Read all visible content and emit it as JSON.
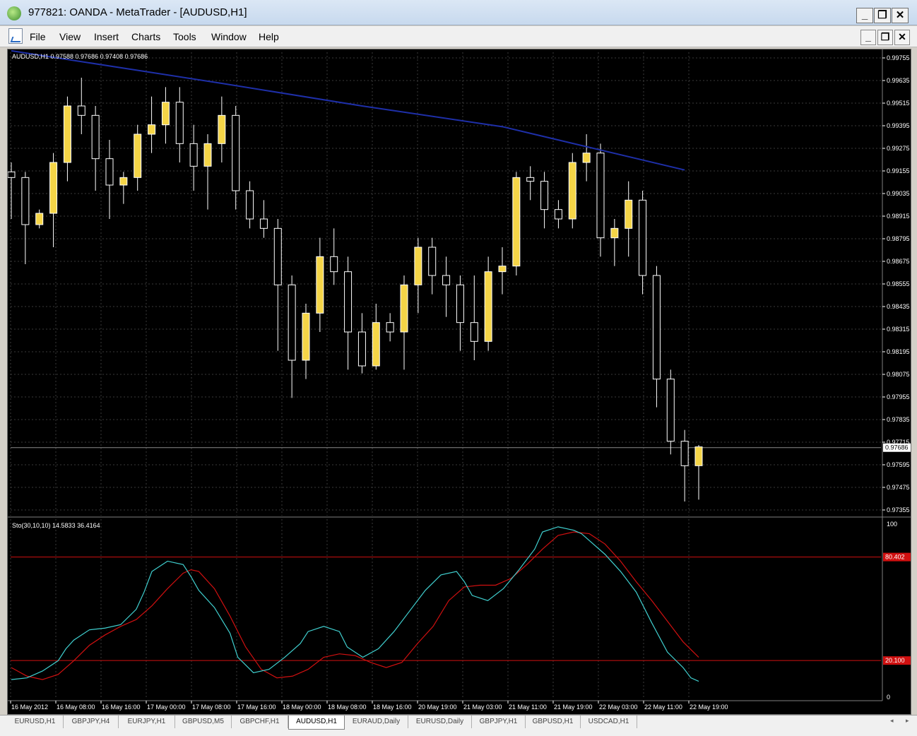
{
  "window": {
    "title": "977821: OANDA - MetaTrader - [AUDUSD,H1]",
    "min_glyph": "_",
    "restore_glyph": "❐",
    "close_glyph": "✕"
  },
  "menu": [
    "File",
    "View",
    "Insert",
    "Charts",
    "Tools",
    "Window",
    "Help"
  ],
  "chart": {
    "info_label": "AUDUSD,H1  0.97588 0.97686 0.97408 0.97686",
    "current_price": "0.97686",
    "price_ticks": [
      "0.99755",
      "0.99635",
      "0.99515",
      "0.99395",
      "0.99275",
      "0.99155",
      "0.99035",
      "0.98915",
      "0.98795",
      "0.98675",
      "0.98555",
      "0.98435",
      "0.98315",
      "0.98195",
      "0.98075",
      "0.97955",
      "0.97835",
      "0.97715",
      "0.97595",
      "0.97475",
      "0.97355"
    ],
    "time_labels": [
      "16 May 2012",
      "16 May 08:00",
      "16 May 16:00",
      "17 May 00:00",
      "17 May 08:00",
      "17 May 16:00",
      "18 May 00:00",
      "18 May 08:00",
      "18 May 16:00",
      "20 May 19:00",
      "21 May 03:00",
      "21 May 11:00",
      "21 May 19:00",
      "22 May 03:00",
      "22 May 11:00",
      "22 May 19:00"
    ],
    "colors": {
      "background": "#000000",
      "bull_body": "#f5d547",
      "bear_body": "#000000",
      "wick": "#ffffff",
      "ma": "#1e2fa8",
      "grid": "#3a3a3a"
    },
    "y_range": [
      0.97355,
      0.99755
    ],
    "ma_line": [
      [
        0,
        0.99793
      ],
      [
        15,
        0.9962
      ],
      [
        25,
        0.995
      ],
      [
        35,
        0.9939
      ],
      [
        48,
        0.9916
      ]
    ],
    "candles": [
      [
        0.9915,
        0.992,
        0.989,
        0.9912
      ],
      [
        0.9912,
        0.9915,
        0.9866,
        0.9887
      ],
      [
        0.9887,
        0.9895,
        0.9885,
        0.9893
      ],
      [
        0.9893,
        0.9925,
        0.9875,
        0.992
      ],
      [
        0.992,
        0.9955,
        0.991,
        0.995
      ],
      [
        0.995,
        0.9965,
        0.9935,
        0.9945
      ],
      [
        0.9945,
        0.995,
        0.9905,
        0.9922
      ],
      [
        0.9922,
        0.9932,
        0.989,
        0.9908
      ],
      [
        0.9908,
        0.9915,
        0.9898,
        0.9912
      ],
      [
        0.9912,
        0.994,
        0.9905,
        0.9935
      ],
      [
        0.9935,
        0.9955,
        0.9925,
        0.994
      ],
      [
        0.994,
        0.996,
        0.993,
        0.9952
      ],
      [
        0.9952,
        0.996,
        0.992,
        0.993
      ],
      [
        0.993,
        0.994,
        0.9905,
        0.9918
      ],
      [
        0.9918,
        0.9935,
        0.9895,
        0.993
      ],
      [
        0.993,
        0.9955,
        0.992,
        0.9945
      ],
      [
        0.9945,
        0.995,
        0.9895,
        0.9905
      ],
      [
        0.9905,
        0.991,
        0.9885,
        0.989
      ],
      [
        0.989,
        0.99,
        0.988,
        0.9885
      ],
      [
        0.9885,
        0.989,
        0.982,
        0.9855
      ],
      [
        0.9855,
        0.986,
        0.9795,
        0.9815
      ],
      [
        0.9815,
        0.9845,
        0.9805,
        0.984
      ],
      [
        0.984,
        0.988,
        0.983,
        0.987
      ],
      [
        0.987,
        0.9885,
        0.9855,
        0.9862
      ],
      [
        0.9862,
        0.987,
        0.981,
        0.983
      ],
      [
        0.983,
        0.984,
        0.9808,
        0.9812
      ],
      [
        0.9812,
        0.9845,
        0.981,
        0.9835
      ],
      [
        0.9835,
        0.984,
        0.9825,
        0.983
      ],
      [
        0.983,
        0.986,
        0.981,
        0.9855
      ],
      [
        0.9855,
        0.988,
        0.984,
        0.9875
      ],
      [
        0.9875,
        0.988,
        0.985,
        0.986
      ],
      [
        0.986,
        0.987,
        0.9838,
        0.9855
      ],
      [
        0.9855,
        0.986,
        0.982,
        0.9835
      ],
      [
        0.9835,
        0.986,
        0.9815,
        0.9825
      ],
      [
        0.9825,
        0.987,
        0.982,
        0.9862
      ],
      [
        0.9862,
        0.9875,
        0.985,
        0.9865
      ],
      [
        0.9865,
        0.9915,
        0.986,
        0.9912
      ],
      [
        0.9912,
        0.9918,
        0.99,
        0.991
      ],
      [
        0.991,
        0.9915,
        0.9885,
        0.9895
      ],
      [
        0.9895,
        0.99,
        0.9885,
        0.989
      ],
      [
        0.989,
        0.9925,
        0.9885,
        0.992
      ],
      [
        0.992,
        0.9935,
        0.991,
        0.9925
      ],
      [
        0.9925,
        0.993,
        0.987,
        0.988
      ],
      [
        0.988,
        0.989,
        0.9865,
        0.9885
      ],
      [
        0.9885,
        0.991,
        0.987,
        0.99
      ],
      [
        0.99,
        0.9905,
        0.985,
        0.986
      ],
      [
        0.986,
        0.9865,
        0.979,
        0.9805
      ],
      [
        0.9805,
        0.981,
        0.9765,
        0.9772
      ],
      [
        0.9772,
        0.9778,
        0.974,
        0.9759
      ],
      [
        0.9759,
        0.977,
        0.9741,
        0.9769
      ]
    ]
  },
  "stochastic": {
    "label": "Sto(30,10,10) 14.5833 36.4164",
    "scale_top": "100",
    "scale_bottom": "0",
    "level_high": "80.402",
    "level_low": "20.100",
    "level_high_value": 80.402,
    "level_low_value": 20.1,
    "main_color": "#40d0d0",
    "signal_color": "#d01010",
    "level_color": "#d01010",
    "main": [
      [
        0,
        9
      ],
      [
        2,
        10
      ],
      [
        4,
        14
      ],
      [
        6,
        20
      ],
      [
        7,
        27
      ],
      [
        8,
        32
      ],
      [
        10,
        38
      ],
      [
        12,
        39
      ],
      [
        14,
        41
      ],
      [
        16,
        50
      ],
      [
        17,
        60
      ],
      [
        18,
        72
      ],
      [
        20,
        78
      ],
      [
        22,
        76
      ],
      [
        23,
        69
      ],
      [
        24,
        61
      ],
      [
        26,
        51
      ],
      [
        28,
        36
      ],
      [
        29,
        22
      ],
      [
        31,
        13
      ],
      [
        33,
        15
      ],
      [
        35,
        22
      ],
      [
        37,
        30
      ],
      [
        38,
        37
      ],
      [
        40,
        40
      ],
      [
        42,
        37
      ],
      [
        43,
        28
      ],
      [
        45,
        22
      ],
      [
        47,
        27
      ],
      [
        49,
        37
      ],
      [
        51,
        49
      ],
      [
        53,
        61
      ],
      [
        55,
        70
      ],
      [
        57,
        72
      ],
      [
        58,
        66
      ],
      [
        59,
        58
      ],
      [
        61,
        55
      ],
      [
        63,
        62
      ],
      [
        65,
        73
      ],
      [
        67,
        85
      ],
      [
        68,
        95
      ],
      [
        70,
        98
      ],
      [
        72,
        96
      ],
      [
        73,
        94
      ],
      [
        74,
        90
      ],
      [
        76,
        82
      ],
      [
        78,
        72
      ],
      [
        80,
        60
      ],
      [
        82,
        42
      ],
      [
        84,
        25
      ],
      [
        86,
        16
      ],
      [
        87,
        10
      ],
      [
        88,
        8
      ]
    ],
    "signal": [
      [
        0,
        16
      ],
      [
        2,
        11
      ],
      [
        4,
        9
      ],
      [
        6,
        12
      ],
      [
        8,
        20
      ],
      [
        10,
        29
      ],
      [
        12,
        35
      ],
      [
        14,
        40
      ],
      [
        16,
        44
      ],
      [
        18,
        52
      ],
      [
        20,
        62
      ],
      [
        22,
        71
      ],
      [
        23,
        73
      ],
      [
        24,
        72
      ],
      [
        26,
        62
      ],
      [
        28,
        46
      ],
      [
        30,
        28
      ],
      [
        32,
        15
      ],
      [
        34,
        10
      ],
      [
        36,
        11
      ],
      [
        38,
        15
      ],
      [
        40,
        22
      ],
      [
        42,
        24
      ],
      [
        44,
        23
      ],
      [
        46,
        19
      ],
      [
        48,
        16
      ],
      [
        50,
        19
      ],
      [
        52,
        30
      ],
      [
        54,
        40
      ],
      [
        56,
        55
      ],
      [
        58,
        63
      ],
      [
        60,
        64
      ],
      [
        62,
        64
      ],
      [
        64,
        68
      ],
      [
        66,
        76
      ],
      [
        68,
        85
      ],
      [
        70,
        93
      ],
      [
        72,
        95
      ],
      [
        74,
        94
      ],
      [
        76,
        88
      ],
      [
        78,
        78
      ],
      [
        80,
        66
      ],
      [
        82,
        55
      ],
      [
        84,
        43
      ],
      [
        86,
        31
      ],
      [
        88,
        22
      ]
    ]
  },
  "symbol_tabs": [
    "EURUSD,H1",
    "GBPJPY,H4",
    "EURJPY,H1",
    "GBPUSD,M5",
    "GBPCHF,H1",
    "AUDUSD,H1",
    "EURAUD,Daily",
    "EURUSD,Daily",
    "GBPJPY,H1",
    "GBPUSD,H1",
    "USDCAD,H1"
  ],
  "active_tab": "AUDUSD,H1"
}
